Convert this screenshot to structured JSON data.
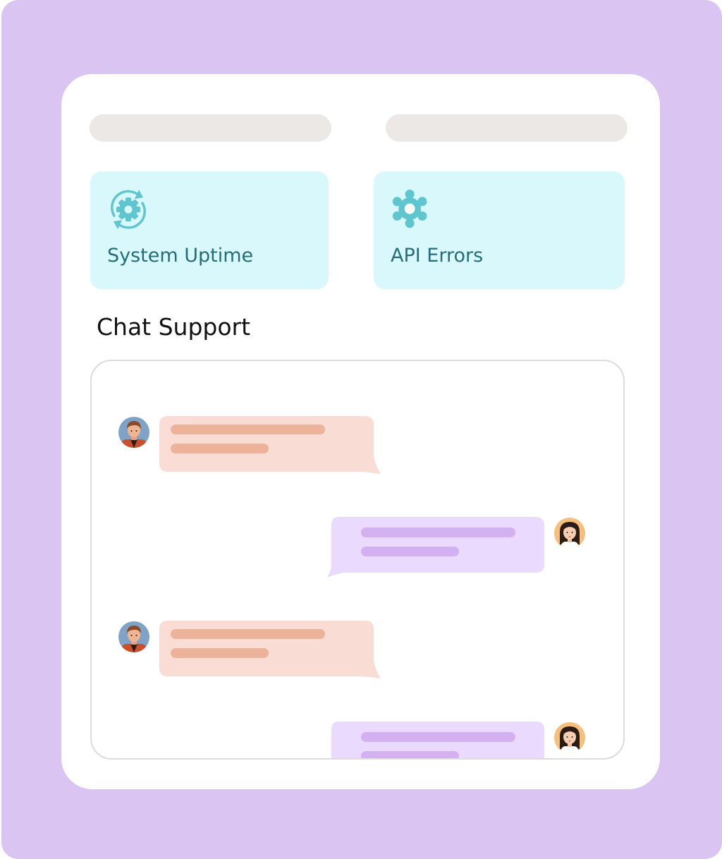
{
  "stats": [
    {
      "label": "System Uptime",
      "icon": "gear-refresh-icon"
    },
    {
      "label": "API Errors",
      "icon": "gear-icon"
    }
  ],
  "chat": {
    "title": "Chat Support",
    "messages": [
      {
        "sender": "agent",
        "avatar": "male-avatar"
      },
      {
        "sender": "user",
        "avatar": "female-avatar"
      },
      {
        "sender": "agent",
        "avatar": "male-avatar"
      },
      {
        "sender": "user",
        "avatar": "female-avatar"
      }
    ]
  },
  "colors": {
    "background": "#d9c4f2",
    "card": "#ffffff",
    "stat_card": "#d9f8fc",
    "stat_accent": "#5fc6cf",
    "stat_text": "#236e78",
    "agent_bubble": "#f9ddd4",
    "agent_line": "#ecb29a",
    "user_bubble": "#eadafd",
    "user_line": "#d3b1f1"
  }
}
